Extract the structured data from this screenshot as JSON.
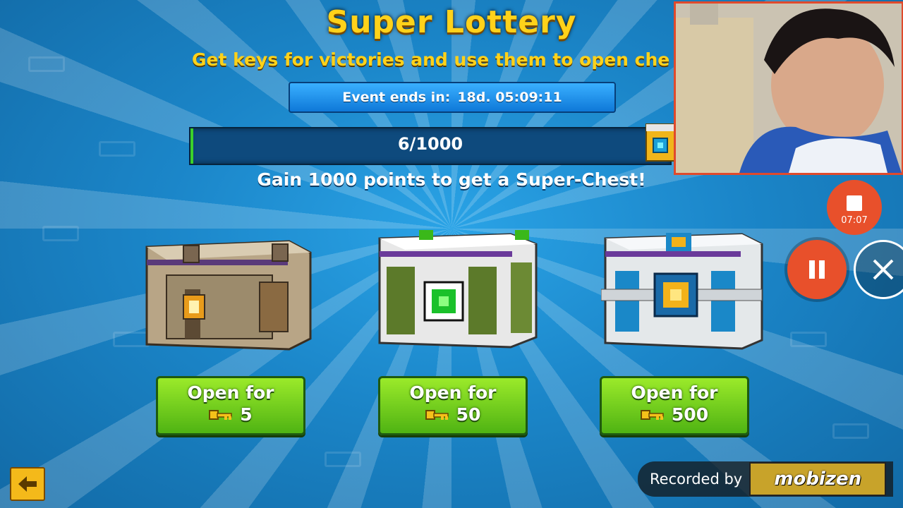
{
  "title": "Super Lottery",
  "subtitle": "Get keys for victories and use them to open che",
  "event": {
    "label": "Event ends in:",
    "time": "18d. 05:09:11"
  },
  "progress": {
    "text": "6/1000",
    "fraction": 0.006
  },
  "goal_text": "Gain 1000 points to get a Super-Chest!",
  "chests": [
    {
      "name": "brown-chest",
      "button_label": "Open for",
      "cost": "5"
    },
    {
      "name": "green-chest",
      "button_label": "Open for",
      "cost": "50"
    },
    {
      "name": "blue-chest",
      "button_label": "Open for",
      "cost": "500"
    }
  ],
  "recorder": {
    "timer": "07:07",
    "recorded_by": "Recorded by",
    "brand": "mobizen"
  },
  "icons": {
    "back": "back-arrow-icon",
    "key": "key-icon",
    "stop": "stop-icon",
    "pause": "pause-icon",
    "close": "close-icon"
  },
  "colors": {
    "accent_yellow": "#ffd21a",
    "button_green": "#6ccf1e",
    "record_red": "#e8502b",
    "event_blue": "#1a90f0"
  }
}
